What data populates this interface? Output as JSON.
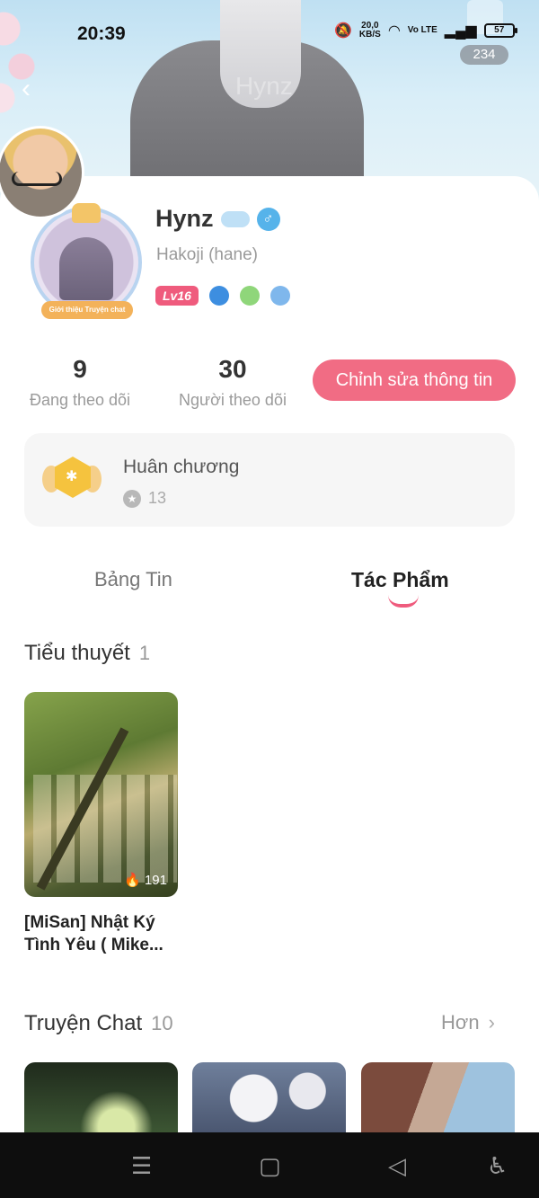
{
  "status_bar": {
    "time": "20:39",
    "net_speed_value": "20,0",
    "net_speed_unit": "KB/S",
    "volte": "Vo LTE",
    "battery": "57"
  },
  "banner": {
    "watermark": "Hynz",
    "like_count": "234"
  },
  "profile": {
    "username": "Hynz",
    "handle": "Hakoji (hane)",
    "level": "Lv16",
    "avatar_banner": "Giới thiệu Truyện chat",
    "gender_symbol": "♂"
  },
  "stats": {
    "following_count": "9",
    "following_label": "Đang theo dõi",
    "followers_count": "30",
    "followers_label": "Người theo dõi",
    "edit_button": "Chỉnh sửa thông tin"
  },
  "medals": {
    "title": "Huân chương",
    "count": "13"
  },
  "tabs": [
    {
      "label": "Bảng Tin",
      "active": false
    },
    {
      "label": "Tác Phẩm",
      "active": true
    }
  ],
  "novels": {
    "title": "Tiểu thuyết",
    "count": "1",
    "items": [
      {
        "title": "[MiSan] Nhật Ký Tình Yêu ( Mike...",
        "views": "191"
      }
    ]
  },
  "chats": {
    "title": "Truyện Chat",
    "count": "10",
    "more": "Hơn"
  },
  "colors": {
    "accent": "#f16c84",
    "level_badge": "#ef5b7d",
    "gender": "#56b3ea"
  }
}
